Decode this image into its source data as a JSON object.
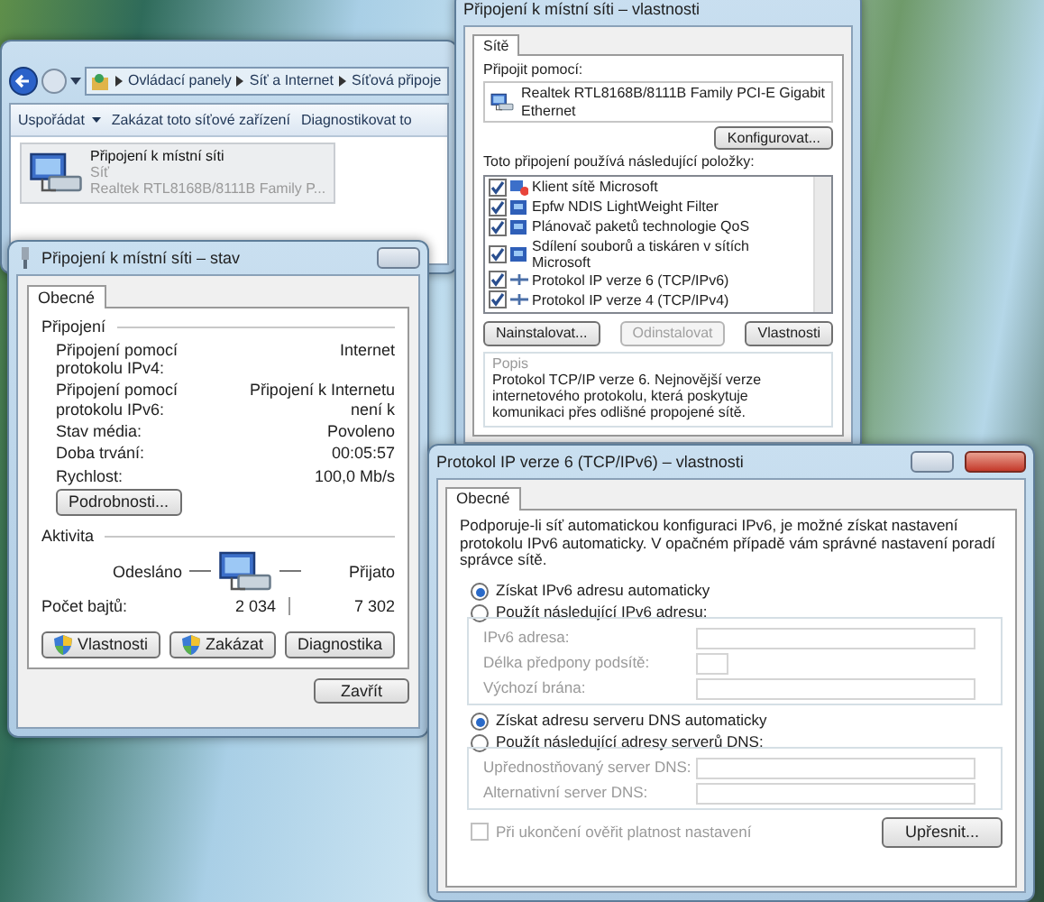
{
  "explorer": {
    "breadcrumb": [
      "Ovládací panely",
      "Síť a Internet",
      "Síťová připoje"
    ],
    "toolbar": [
      {
        "label": "Uspořádat",
        "dropdown": true
      },
      {
        "label": "Zakázat toto síťové zařízení",
        "dropdown": false
      },
      {
        "label": "Diagnostikovat to",
        "dropdown": false
      }
    ],
    "connection": {
      "name": "Připojení k místní síti",
      "network": "Síť",
      "adapter": "Realtek RTL8168B/8111B Family P...",
      "selected": true
    }
  },
  "status_dialog": {
    "title": "Připojení k místní síti – stav",
    "tabs": [
      {
        "label": "Obecné",
        "selected": true
      }
    ],
    "connection_group": "Připojení",
    "rows": [
      {
        "label": "Připojení pomocí protokolu IPv4:",
        "value": "Internet"
      },
      {
        "label": "Připojení pomocí protokolu IPv6:",
        "value": "Připojení k Internetu není k"
      },
      {
        "label": "Stav média:",
        "value": "Povoleno"
      },
      {
        "label": "Doba trvání:",
        "value": "00:05:57"
      },
      {
        "label": "Rychlost:",
        "value": "100,0 Mb/s"
      }
    ],
    "details_button": "Podrobnosti...",
    "activity_group": "Aktivita",
    "sent_label": "Odesláno",
    "received_label": "Přijato",
    "bytes_label": "Počet bajtů:",
    "bytes_sent": "2 034",
    "bytes_received": "7 302",
    "buttons": [
      {
        "label": "Vlastnosti",
        "shield": true
      },
      {
        "label": "Zakázat",
        "shield": true
      },
      {
        "label": "Diagnostika",
        "shield": false
      }
    ],
    "close_button": "Zavřít"
  },
  "properties_dialog": {
    "title": "Připojení k místní síti – vlastnosti",
    "tabs": [
      {
        "label": "Sítě",
        "selected": true
      }
    ],
    "connect_using_label": "Připojit pomocí:",
    "adapter": "Realtek RTL8168B/8111B Family PCI-E Gigabit Ethernet",
    "configure_button": "Konfigurovat...",
    "items_label": "Toto připojení používá následující položky:",
    "items": [
      {
        "label": "Klient sítě Microsoft",
        "checked": true,
        "kind": "client"
      },
      {
        "label": "Epfw NDIS LightWeight Filter",
        "checked": true,
        "kind": "service"
      },
      {
        "label": "Plánovač paketů technologie QoS",
        "checked": true,
        "kind": "service"
      },
      {
        "label": "Sdílení souborů a tiskáren v sítích Microsoft",
        "checked": true,
        "kind": "service"
      },
      {
        "label": "Protokol IP verze 6 (TCP/IPv6)",
        "checked": true,
        "kind": "protocol"
      },
      {
        "label": "Protokol IP verze 4 (TCP/IPv4)",
        "checked": true,
        "kind": "protocol"
      }
    ],
    "buttons": [
      {
        "label": "Nainstalovat...",
        "disabled": false
      },
      {
        "label": "Odinstalovat",
        "disabled": true
      },
      {
        "label": "Vlastnosti",
        "disabled": false
      }
    ],
    "description_group": "Popis",
    "description": "Protokol TCP/IP verze 6. Nejnovější verze internetového protokolu, která poskytuje komunikaci přes odlišné propojené sítě."
  },
  "ipv6_dialog": {
    "title": "Protokol IP verze 6 (TCP/IPv6) – vlastnosti",
    "tabs": [
      {
        "label": "Obecné",
        "selected": true
      }
    ],
    "intro": "Podporuje-li síť automatickou konfiguraci IPv6, je možné získat nastavení protokolu IPv6 automaticky. V opačném případě vám správné nastavení poradí správce sítě.",
    "address_options": [
      {
        "label": "Získat IPv6 adresu automaticky",
        "selected": true
      },
      {
        "label": "Použít následující IPv6 adresu:",
        "selected": false
      }
    ],
    "address_fields": [
      {
        "label": "IPv6 adresa:",
        "kind": "wide"
      },
      {
        "label": "Délka předpony podsítě:",
        "kind": "short"
      },
      {
        "label": "Výchozí brána:",
        "kind": "wide"
      }
    ],
    "dns_options": [
      {
        "label": "Získat adresu serveru DNS automaticky",
        "selected": true
      },
      {
        "label": "Použít následující adresy serverů DNS:",
        "selected": false
      }
    ],
    "dns_fields": [
      {
        "label": "Upřednostňovaný server DNS:",
        "kind": "wide"
      },
      {
        "label": "Alternativní server DNS:",
        "kind": "wide"
      }
    ],
    "validate": {
      "label": "Při ukončení ověřit platnost nastavení",
      "checked": false,
      "disabled": true
    },
    "advanced_button": "Upřesnit..."
  }
}
